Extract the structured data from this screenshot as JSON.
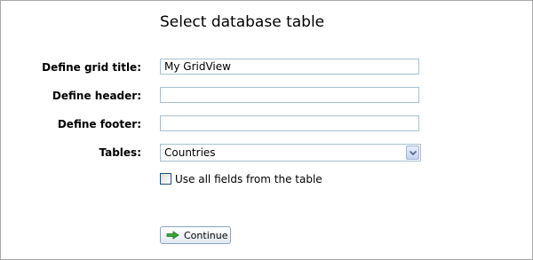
{
  "page": {
    "title": "Select database table"
  },
  "form": {
    "grid_title": {
      "label": "Define grid title:",
      "value": "My GridView"
    },
    "header": {
      "label": "Define header:",
      "value": ""
    },
    "footer": {
      "label": "Define footer:",
      "value": ""
    },
    "tables": {
      "label": "Tables:",
      "selected": "Countries"
    },
    "use_all_fields": {
      "label": "Use all fields from the table",
      "checked": false
    },
    "continue_button": {
      "label": "Continue",
      "icon": "green-right-arrow-icon"
    }
  },
  "colors": {
    "field_border": "#a7c0cc",
    "button_border": "#8ba4c4",
    "arrow_green": "#3aa53a"
  }
}
